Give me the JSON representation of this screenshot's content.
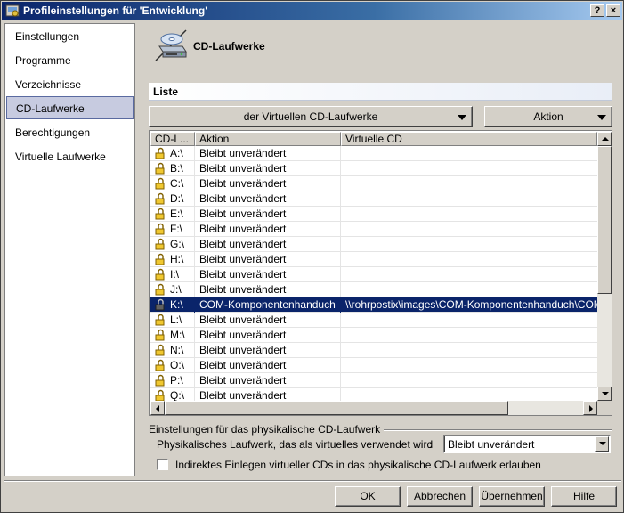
{
  "window": {
    "title": "Profileinstellungen für 'Entwicklung'"
  },
  "titlebar_buttons": {
    "help": "?",
    "close": "×"
  },
  "nav": {
    "items": [
      {
        "label": "Einstellungen",
        "selected": false
      },
      {
        "label": "Programme",
        "selected": false
      },
      {
        "label": "Verzeichnisse",
        "selected": false
      },
      {
        "label": "CD-Laufwerke",
        "selected": true
      },
      {
        "label": "Berechtigungen",
        "selected": false
      },
      {
        "label": "Virtuelle Laufwerke",
        "selected": false
      }
    ]
  },
  "header": {
    "title": "CD-Laufwerke",
    "icon": "cd-drive-icon"
  },
  "list": {
    "section_label": "Liste",
    "dropdown_label": "der Virtuellen CD-Laufwerke",
    "action_label": "Aktion",
    "columns": [
      "CD-L...",
      "Aktion",
      "Virtuelle CD"
    ],
    "rows": [
      {
        "drive": "A:\\",
        "action": "Bleibt unverändert",
        "cd": "",
        "selected": false
      },
      {
        "drive": "B:\\",
        "action": "Bleibt unverändert",
        "cd": "",
        "selected": false
      },
      {
        "drive": "C:\\",
        "action": "Bleibt unverändert",
        "cd": "",
        "selected": false
      },
      {
        "drive": "D:\\",
        "action": "Bleibt unverändert",
        "cd": "",
        "selected": false
      },
      {
        "drive": "E:\\",
        "action": "Bleibt unverändert",
        "cd": "",
        "selected": false
      },
      {
        "drive": "F:\\",
        "action": "Bleibt unverändert",
        "cd": "",
        "selected": false
      },
      {
        "drive": "G:\\",
        "action": "Bleibt unverändert",
        "cd": "",
        "selected": false
      },
      {
        "drive": "H:\\",
        "action": "Bleibt unverändert",
        "cd": "",
        "selected": false
      },
      {
        "drive": "I:\\",
        "action": "Bleibt unverändert",
        "cd": "",
        "selected": false
      },
      {
        "drive": "J:\\",
        "action": "Bleibt unverändert",
        "cd": "",
        "selected": false
      },
      {
        "drive": "K:\\",
        "action": "COM-Komponentenhanduch",
        "cd": "\\\\rohrpostix\\images\\COM-Komponentenhanduch\\COM-Kom",
        "selected": true
      },
      {
        "drive": "L:\\",
        "action": "Bleibt unverändert",
        "cd": "",
        "selected": false
      },
      {
        "drive": "M:\\",
        "action": "Bleibt unverändert",
        "cd": "",
        "selected": false
      },
      {
        "drive": "N:\\",
        "action": "Bleibt unverändert",
        "cd": "",
        "selected": false
      },
      {
        "drive": "O:\\",
        "action": "Bleibt unverändert",
        "cd": "",
        "selected": false
      },
      {
        "drive": "P:\\",
        "action": "Bleibt unverändert",
        "cd": "",
        "selected": false
      },
      {
        "drive": "Q:\\",
        "action": "Bleibt unverändert",
        "cd": "",
        "selected": false
      }
    ]
  },
  "physical": {
    "group_title": "Einstellungen für das physikalische CD-Laufwerk",
    "label": "Physikalisches Laufwerk, das als virtuelles verwendet wird",
    "colon": ":",
    "select_value": "Bleibt unverändert",
    "checkbox_label": "Indirektes Einlegen virtueller CDs in das physikalische CD-Laufwerk erlauben",
    "checkbox_checked": false
  },
  "buttons": {
    "ok": "OK",
    "cancel": "Abbrechen",
    "apply": "Übernehmen",
    "help": "Hilfe"
  }
}
